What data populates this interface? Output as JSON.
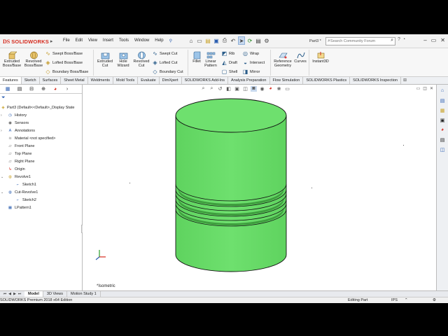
{
  "app": {
    "brand_mark": "DS",
    "brand_name": "SOLIDWORKS",
    "document_name": "Part3 *"
  },
  "menu": [
    "File",
    "Edit",
    "View",
    "Insert",
    "Tools",
    "Window",
    "Help"
  ],
  "search": {
    "placeholder": "Search Community Forum"
  },
  "ribbon": {
    "extruded_boss": "Extruded Boss/Base",
    "revolved_boss": "Revolved Boss/Base",
    "swept_boss": "Swept Boss/Base",
    "lofted_boss": "Lofted Boss/Base",
    "boundary_boss": "Boundary Boss/Base",
    "extruded_cut": "Extruded Cut",
    "hole_wizard": "Hole Wizard",
    "revolved_cut": "Revolved Cut",
    "swept_cut": "Swept Cut",
    "lofted_cut": "Lofted Cut",
    "boundary_cut": "Boundary Cut",
    "fillet": "Fillet",
    "linear_pattern": "Linear Pattern",
    "rib": "Rib",
    "draft": "Draft",
    "shell": "Shell",
    "wrap": "Wrap",
    "intersect": "Intersect",
    "mirror": "Mirror",
    "reference_geometry": "Reference Geometry",
    "curves": "Curves",
    "instant3d": "Instant3D"
  },
  "command_tabs": [
    "Features",
    "Sketch",
    "Surfaces",
    "Sheet Metal",
    "Weldments",
    "Mold Tools",
    "Evaluate",
    "DimXpert",
    "SOLIDWORKS Add-Ins",
    "Analysis Preparation",
    "Flow Simulation",
    "SOLIDWORKS Plastics",
    "SOLIDWORKS Inspection"
  ],
  "tree": {
    "root": "Part3  (Default<<Default>_Display State",
    "items": [
      {
        "label": "History",
        "icon": "history-icon"
      },
      {
        "label": "Sensors",
        "icon": "sensor-icon"
      },
      {
        "label": "Annotations",
        "icon": "annotations-icon"
      },
      {
        "label": "Material <not specified>",
        "icon": "material-icon"
      },
      {
        "label": "Front Plane",
        "icon": "plane-icon"
      },
      {
        "label": "Top Plane",
        "icon": "plane-icon"
      },
      {
        "label": "Right Plane",
        "icon": "plane-icon"
      },
      {
        "label": "Origin",
        "icon": "origin-icon"
      },
      {
        "label": "Revolve1",
        "icon": "revolve-icon"
      },
      {
        "label": "Sketch1",
        "icon": "sketch-icon"
      },
      {
        "label": "Cut-Revolve1",
        "icon": "cut-revolve-icon"
      },
      {
        "label": "Sketch2",
        "icon": "sketch-icon"
      },
      {
        "label": "LPattern1",
        "icon": "linear-pattern-icon"
      }
    ]
  },
  "viewport": {
    "view_label": "*Isometric",
    "part_color": "#6ee06e"
  },
  "bottom_tabs": [
    "Model",
    "3D Views",
    "Motion Study 1"
  ],
  "status": {
    "edition": "SOLIDWORKS Premium 2018 x64 Edition",
    "mode": "Editing Part",
    "units": "IPS"
  },
  "colors": {
    "accent": "#d52b1e",
    "selection": "#c8d9ee"
  }
}
